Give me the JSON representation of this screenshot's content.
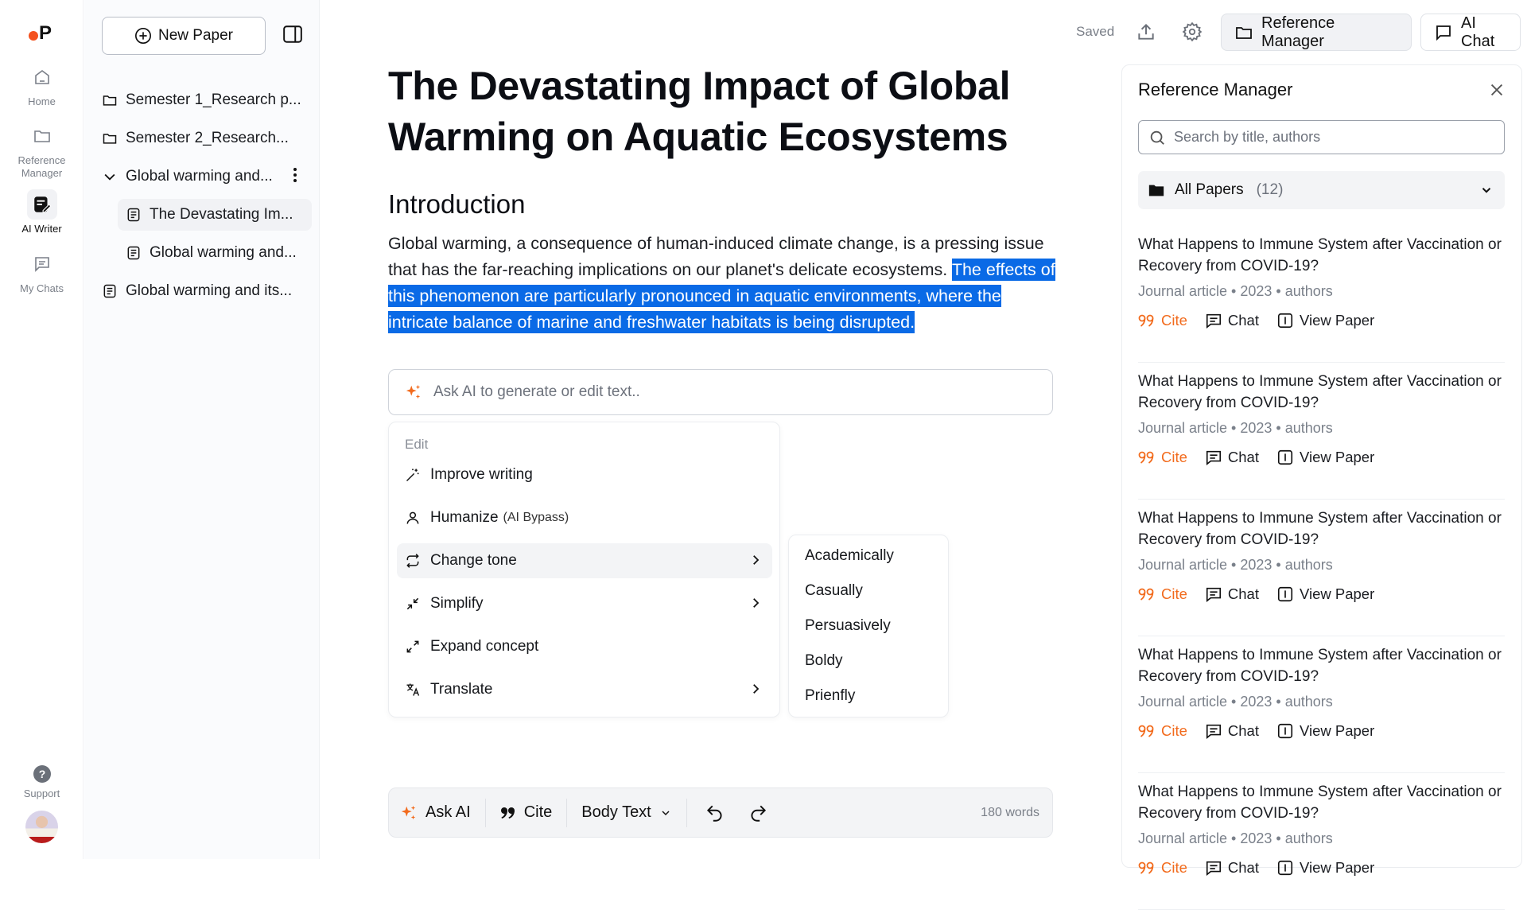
{
  "rail": {
    "logo": "P",
    "items": [
      {
        "label": "Home",
        "icon": "home-icon"
      },
      {
        "label": "Reference Manager",
        "icon": "folder-icon"
      },
      {
        "label": "AI Writer",
        "icon": "pen-icon",
        "active": true
      },
      {
        "label": "My Chats",
        "icon": "chat-icon"
      }
    ],
    "support_label": "Support"
  },
  "files": {
    "new_paper_label": "New Paper",
    "tree": [
      {
        "label": "Semester 1_Research p...",
        "type": "folder"
      },
      {
        "label": "Semester 2_Research...",
        "type": "folder"
      },
      {
        "label": "Global warming and...",
        "type": "folder-expanded"
      },
      {
        "label": "The Devastating Im...",
        "type": "doc",
        "selected": true
      },
      {
        "label": "Global warming and...",
        "type": "doc"
      },
      {
        "label": "Global warming and its...",
        "type": "doc"
      }
    ]
  },
  "header": {
    "status": "Saved",
    "reference_manager_label": "Reference Manager",
    "ai_chat_label": "AI Chat"
  },
  "editor": {
    "title": "The Devastating Impact of Global Warming on Aquatic Ecosystems",
    "heading": "Introduction",
    "para_plain": "Global warming, a consequence of human-induced climate change, is a pressing issue that has the far-reaching implications on our planet's delicate ecosystems. ",
    "para_selected": "The effects of this phenomenon are particularly pronounced in aquatic environments, where the intricate balance of marine and freshwater habitats is being disrupted.",
    "ask_ai_placeholder": "Ask AI to generate or edit text..",
    "menu": {
      "section_label": "Edit",
      "items": [
        {
          "label": "Improve writing",
          "icon": "magic-wand-icon"
        },
        {
          "label": "Humanize",
          "sub": "(AI Bypass)",
          "icon": "user-icon"
        },
        {
          "label": "Change tone",
          "icon": "repeat-icon",
          "submenu": true,
          "hovered": true
        },
        {
          "label": "Simplify",
          "icon": "minimize-icon",
          "submenu": true
        },
        {
          "label": "Expand concept",
          "icon": "maximize-icon"
        },
        {
          "label": "Translate",
          "icon": "translate-icon",
          "submenu": true
        }
      ]
    },
    "tone_options": [
      "Academically",
      "Casually",
      "Persuasively",
      "Boldy",
      "Prienfly"
    ],
    "toolbar": {
      "ask_ai_label": "Ask AI",
      "cite_label": "Cite",
      "style_label": "Body Text",
      "word_count": "180 words"
    }
  },
  "reference_panel": {
    "title": "Reference Manager",
    "search_placeholder": "Search by title, authors",
    "filter_label": "All Papers",
    "filter_count": "(12)",
    "references": [
      {
        "title": "What Happens to Immune System after Vaccination or Recovery from COVID-19?",
        "meta": "Journal article • 2023 • authors"
      },
      {
        "title": "What Happens to Immune System after Vaccination or Recovery from COVID-19?",
        "meta": "Journal article • 2023 • authors"
      },
      {
        "title": "What Happens to Immune System after Vaccination or Recovery from COVID-19?",
        "meta": "Journal article • 2023 • authors"
      },
      {
        "title": "What Happens to Immune System after Vaccination or Recovery from COVID-19?",
        "meta": "Journal article • 2023 • authors"
      },
      {
        "title": "What Happens to Immune System after Vaccination or Recovery from COVID-19?",
        "meta": "Journal article • 2023 • authors"
      }
    ],
    "actions": {
      "cite": "Cite",
      "chat": "Chat",
      "view": "View Paper"
    }
  },
  "colors": {
    "accent": "#f26b1d",
    "selection": "#0a6ae6"
  }
}
